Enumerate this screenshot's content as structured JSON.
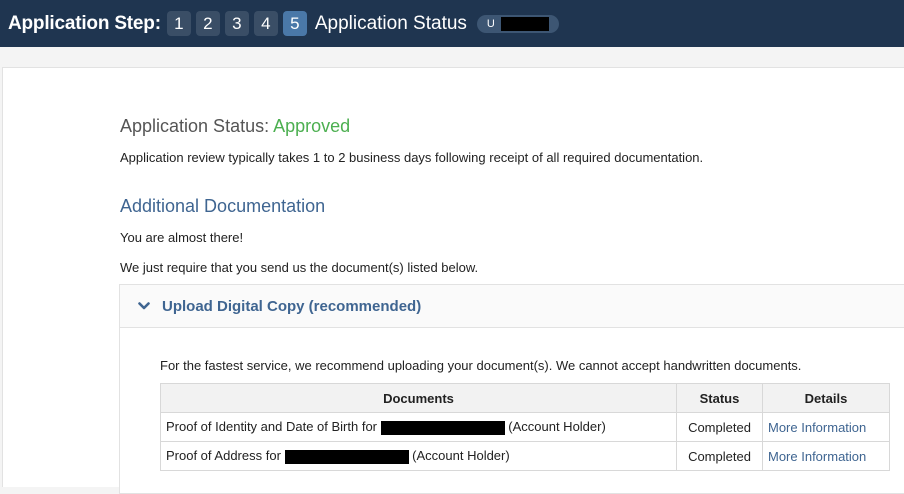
{
  "header": {
    "title": "Application Step:",
    "steps": [
      "1",
      "2",
      "3",
      "4",
      "5"
    ],
    "active_step": "5",
    "status_label": "Application Status",
    "user_initial": "U"
  },
  "main": {
    "status_prefix": "Application Status:",
    "status_value": "Approved",
    "review_note": "Application review typically takes 1 to 2 business days following receipt of all required documentation.",
    "additional_heading": "Additional Documentation",
    "almost_there": "You are almost there!",
    "require_text": "We just require that you send us the document(s) listed below."
  },
  "upload": {
    "title": "Upload Digital Copy (recommended)",
    "note": "For the fastest service, we recommend uploading your document(s). We cannot accept handwritten documents.",
    "columns": [
      "Documents",
      "Status",
      "Details"
    ],
    "rows": [
      {
        "doc_prefix": "Proof of Identity and Date of Birth for",
        "doc_suffix": "(Account Holder)",
        "status": "Completed",
        "details": "More Information"
      },
      {
        "doc_prefix": "Proof of Address for",
        "doc_suffix": "(Account Holder)",
        "status": "Completed",
        "details": "More Information"
      }
    ]
  },
  "colors": {
    "topbar": "#1f3550",
    "approved": "#4caf50",
    "link": "#3f6591"
  }
}
